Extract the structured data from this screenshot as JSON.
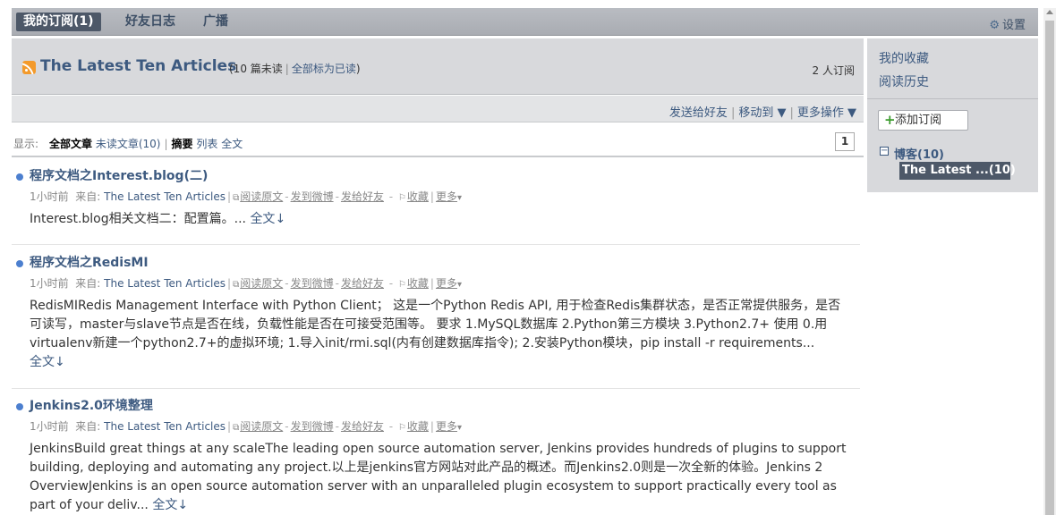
{
  "nav": {
    "tabs": [
      {
        "label": "我的订阅(1)"
      },
      {
        "label": "好友日志"
      },
      {
        "label": "广播"
      }
    ],
    "settings_label": "设置"
  },
  "feed": {
    "title": "The Latest Ten Articles",
    "unread_prefix": "(10",
    "unread_text": "篇未读",
    "mark_all_read": "全部标为已读",
    "closing": ")",
    "subscribers": "2 人订阅"
  },
  "actions": {
    "send": "发送给好友",
    "move": "移动到 ▼",
    "more": "更多操作 ▼"
  },
  "view": {
    "label": "显示:",
    "all": "全部文章",
    "unread": "未读文章(10)",
    "summary": "摘要",
    "list": "列表",
    "full": "全文",
    "page": "1"
  },
  "article_meta_labels": {
    "from": "来自:",
    "read_original": "阅读原文",
    "post_weibo": "发到微博",
    "send_friend": "发给好友",
    "favorite": "收藏",
    "more": "更多",
    "full_text": "全文"
  },
  "articles": [
    {
      "title": "程序文档之Interest.blog(二)",
      "time": "1小时前",
      "source": "The Latest Ten Articles",
      "summary": "Interest.blog相关文档二：配置篇。..."
    },
    {
      "title": "程序文档之RedisMI",
      "time": "1小时前",
      "source": "The Latest Ten Articles",
      "summary": "RedisMIRedis Management Interface with Python Client； 这是一个Python Redis API, 用于检查Redis集群状态，是否正常提供服务，是否可读写，master与slave节点是否在线，负载性能是否在可接受范围等。 要求 1.MySQL数据库 2.Python第三方模块 3.Python2.7+ 使用 0.用virtualenv新建一个python2.7+的虚拟环境; 1.导入init/rmi.sql(内有创建数据库指令); 2.安装Python模块，pip install -r requirements..."
    },
    {
      "title": "Jenkins2.0环境整理",
      "time": "1小时前",
      "source": "The Latest Ten Articles",
      "summary": "JenkinsBuild great things at any scaleThe leading open source automation server, Jenkins provides hundreds of plugins to support building, deploying and automating any project.以上是jenkins官方网站对此产品的概述。而Jenkins2.0则是一次全新的体验。Jenkins 2 OverviewJenkins is an open source automation server with an unparalleled plugin ecosystem to support practically every tool as part of your deliv..."
    }
  ],
  "sidebar": {
    "favorites": "我的收藏",
    "history": "阅读历史",
    "add_subscription": "添加订阅",
    "folder": "博客(10)",
    "selected_feed": "The Latest ...(10)"
  },
  "colors": {
    "accent": "#3d5a80",
    "nav_active": "#4d5868",
    "unread_dot": "#4c7fcf",
    "rss": "#f39a2b"
  }
}
